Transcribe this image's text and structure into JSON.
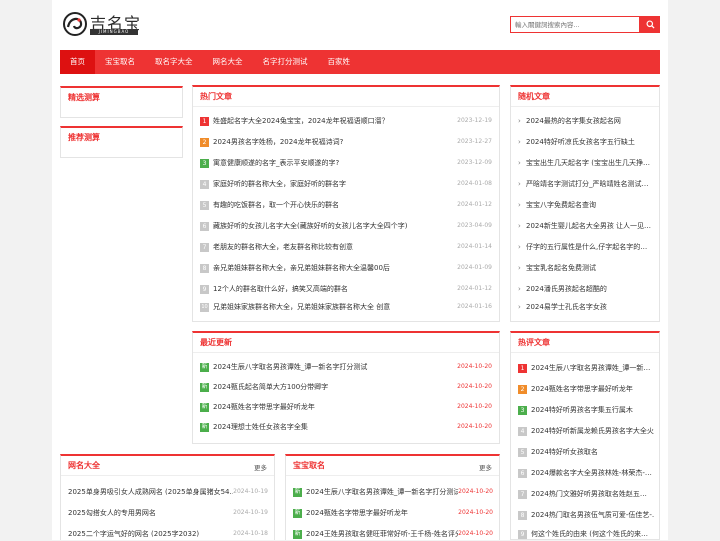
{
  "header": {
    "logo_text": "吉名宝",
    "logo_sub": "JIMINGBAO",
    "search_placeholder": "輸入關鍵詞搜索內容..."
  },
  "nav": [
    "首页",
    "宝宝取名",
    "取名字大全",
    "网名大全",
    "名字打分测试",
    "百家姓"
  ],
  "left": {
    "featured_title": "精选测算",
    "recommended_title": "推荐测算"
  },
  "hot": {
    "title": "热门文章",
    "items": [
      {
        "n": "1",
        "text": "姓盛起名字大全2024兔宝宝，2024龙年祝福语顺口溜？",
        "date": "2023-12-19"
      },
      {
        "n": "2",
        "text": "2024男孩名字姓杨，2024龙年祝福诗词?",
        "date": "2023-12-27"
      },
      {
        "n": "3",
        "text": "寓意健康顺遂的名字_表示平安顺遂的字?",
        "date": "2023-12-09"
      },
      {
        "n": "4",
        "text": "家庭好听的群名称大全，家庭好听的群名字",
        "date": "2024-01-08"
      },
      {
        "n": "5",
        "text": "有趣的吃饭群名，取一个开心快乐的群名",
        "date": "2024-01-12"
      },
      {
        "n": "6",
        "text": "藏族好听的女孩儿名字大全(藏族好听的女孩儿名字大全四个字)",
        "date": "2023-04-09"
      },
      {
        "n": "7",
        "text": "老朋友的群名称大全，老友群名称比较有创意",
        "date": "2024-01-14"
      },
      {
        "n": "8",
        "text": "亲兄弟姐妹群名称大全，亲兄弟姐妹群名称大全温馨00后",
        "date": "2024-01-09"
      },
      {
        "n": "9",
        "text": "12个人的群名取什么好，搞笑又高端的群名",
        "date": "2024-01-12"
      },
      {
        "n": "10",
        "text": "兄弟姐妹家族群名称大全，兄弟姐妹家族群名称大全 创意",
        "date": "2024-01-16"
      }
    ]
  },
  "random": {
    "title": "随机文章",
    "items": [
      "2024最热的名字集女孩起名网",
      "2024特好听凉氏女孩名字五行缺土",
      "宝宝出生几天起名字 (宝宝出生几天挣…",
      "严晗靖名字测试打分_严晗靖姓名测试…",
      "宝宝八字免费起名查询",
      "2024新生婴儿起名大全男孩 让人一见…",
      "仔字的五行属性是什么,仔字起名字的…",
      "宝宝乳名起名免费测试",
      "2024潘氏男孩起名超酷的",
      "2024易学士孔氏名字女孩"
    ]
  },
  "latest": {
    "title": "最近更新",
    "badge": "新",
    "items": [
      {
        "text": "2024生辰八字取名男孩谭姓_谭一新名字打分测试",
        "date": "2024-10-20"
      },
      {
        "text": "2024甄氏起名简单大方100分带卿字",
        "date": "2024-10-20"
      },
      {
        "text": "2024甄姓名字带思字最好听龙年",
        "date": "2024-10-20"
      },
      {
        "text": "2024理想士姓任女孩名字全集",
        "date": "2024-10-20"
      }
    ]
  },
  "ranking": {
    "title": "热评文章",
    "items": [
      {
        "n": "1",
        "text": "2024生辰八字取名男孩谭姓_谭一新…"
      },
      {
        "n": "2",
        "text": "2024甄姓名字带思字最好听龙年"
      },
      {
        "n": "3",
        "text": "2024特好听男孩名字集五行属木"
      },
      {
        "n": "4",
        "text": "2024特好听新属龙赖氏男孩名字大全火"
      },
      {
        "n": "5",
        "text": "2024特好听女孩取名"
      },
      {
        "n": "6",
        "text": "2024爆款名字大全男孩林姓-林荣杰-…"
      },
      {
        "n": "7",
        "text": "2024热门文雅好听男孩取名姓赵五…"
      },
      {
        "n": "8",
        "text": "2024热门取名男孩伍气质可爱-伍佳艺-…"
      },
      {
        "n": "9",
        "text": "何这个姓氏的由来 (何这个姓氏的来…"
      }
    ]
  },
  "netname": {
    "title": "网名大全",
    "more": "更多",
    "items": [
      {
        "text": "2025单身男吸引女人成熟网名 (2025单身属猪女54…",
        "date": "2024-10-19"
      },
      {
        "text": "2025勾搭女人的专用男网名",
        "date": "2024-10-19"
      },
      {
        "text": "2025二个字运气好的网名 (2025字2032)",
        "date": "2024-10-18"
      }
    ]
  },
  "babyname": {
    "title": "宝宝取名",
    "more": "更多",
    "badge": "新",
    "items": [
      {
        "text": "2024生辰八字取名男孩谭姓_谭一新名字打分测试",
        "date": "2024-10-20"
      },
      {
        "text": "2024甄姓名字带思字最好听龙年",
        "date": "2024-10-20"
      },
      {
        "text": "2024王姓男孩取名健旺菲常好听-王千杨-姓名评分",
        "date": "2024-10-20"
      }
    ]
  },
  "colors": {
    "accent": "#e33333"
  }
}
